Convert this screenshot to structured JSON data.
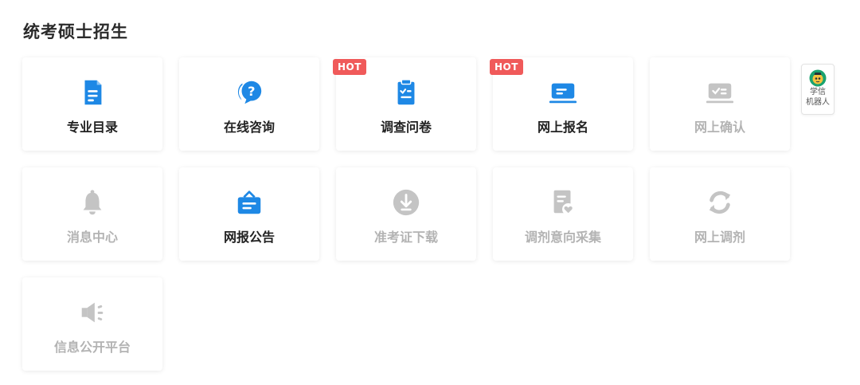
{
  "section": {
    "title": "统考硕士招生"
  },
  "cards": [
    {
      "label": "专业目录",
      "icon": "document-list-icon",
      "hot": false,
      "enabled": true
    },
    {
      "label": "在线咨询",
      "icon": "question-chat-icon",
      "hot": false,
      "enabled": true
    },
    {
      "label": "调查问卷",
      "icon": "clipboard-checklist-icon",
      "hot": true,
      "enabled": true
    },
    {
      "label": "网上报名",
      "icon": "laptop-icon",
      "hot": true,
      "enabled": true
    },
    {
      "label": "网上确认",
      "icon": "laptop-check-icon",
      "hot": false,
      "enabled": false
    },
    {
      "label": "消息中心",
      "icon": "bell-icon",
      "hot": false,
      "enabled": false
    },
    {
      "label": "网报公告",
      "icon": "announcement-board-icon",
      "hot": false,
      "enabled": true
    },
    {
      "label": "准考证下载",
      "icon": "download-icon",
      "hot": false,
      "enabled": false
    },
    {
      "label": "调剂意向采集",
      "icon": "document-heart-icon",
      "hot": false,
      "enabled": false
    },
    {
      "label": "网上调剂",
      "icon": "refresh-icon",
      "hot": false,
      "enabled": false
    },
    {
      "label": "信息公开平台",
      "icon": "megaphone-icon",
      "hot": false,
      "enabled": false
    }
  ],
  "badge": {
    "hot_label": "HOT"
  },
  "robot": {
    "line1": "学信",
    "line2": "机器人",
    "icon": "robot-avatar-icon"
  },
  "colors": {
    "accent": "#1e88e5",
    "disabled": "#c4c4c4",
    "hot": "#f05a5a"
  }
}
